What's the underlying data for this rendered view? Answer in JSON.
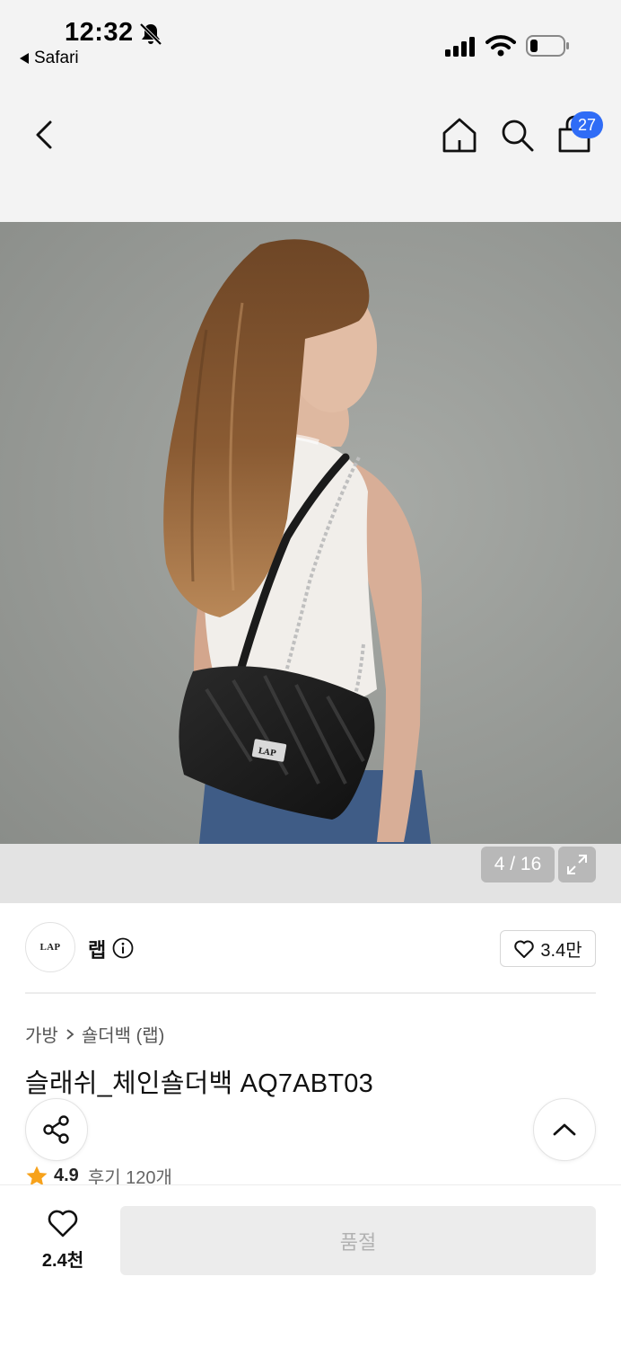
{
  "status_bar": {
    "time": "12:32",
    "back_app": "Safari",
    "icons": [
      "bell-slash-icon",
      "signal-icon",
      "wifi-icon",
      "battery-icon"
    ]
  },
  "header": {
    "icons": [
      "back-arrow-icon",
      "home-icon",
      "search-icon",
      "shopping-bag-icon"
    ],
    "cart_count": "27",
    "badge_color": "#2f6cf6"
  },
  "gallery": {
    "counter": "4 / 16",
    "current": 4,
    "total": 16,
    "image_logo_text": "LAP"
  },
  "brand": {
    "logo_text": "LAP",
    "name": "랩",
    "follower_count": "3.4만"
  },
  "product": {
    "breadcrumb": [
      "가방",
      "숄더백 (랩)"
    ],
    "title": "슬래쉬_체인숄더백 AQ7ABT03",
    "rating": "4.9",
    "reviews_label": "후기 120개",
    "star_color": "#f7a21b"
  },
  "bottom_bar": {
    "like_count": "2.4천",
    "buy_label": "품절"
  }
}
